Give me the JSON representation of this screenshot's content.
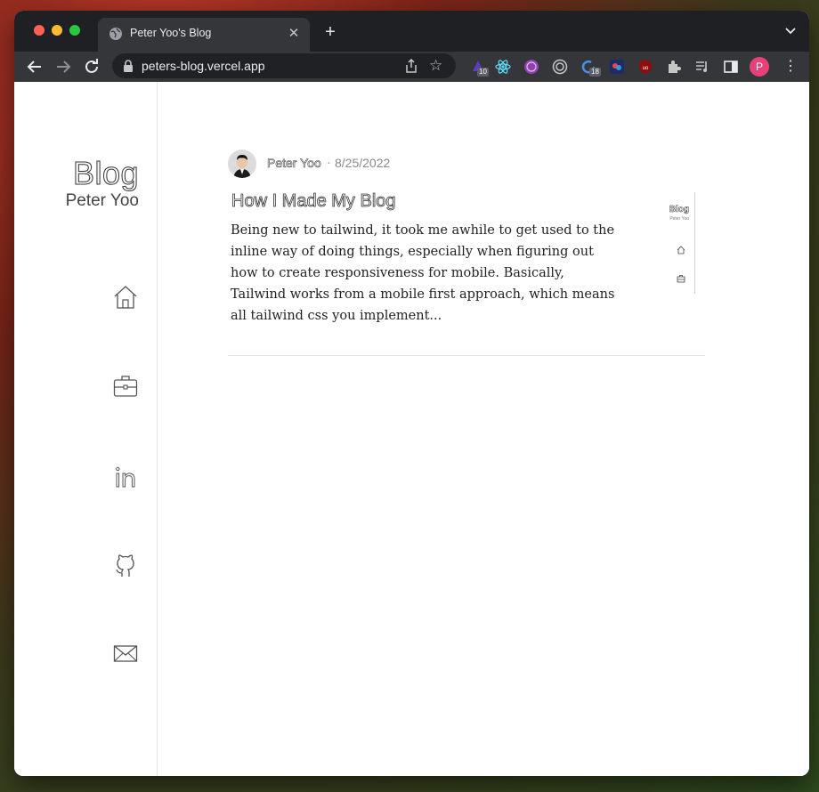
{
  "browser": {
    "tab_title": "Peter Yoo's Blog",
    "url": "peters-blog.vercel.app",
    "extensions": [
      {
        "name": "ext-wizard-icon",
        "badge": "10"
      },
      {
        "name": "react-devtools-icon",
        "badge": ""
      },
      {
        "name": "ext-globe-icon",
        "badge": ""
      },
      {
        "name": "ext-target-icon",
        "badge": ""
      },
      {
        "name": "ext-refresh-icon",
        "badge": "18"
      },
      {
        "name": "ext-colorful-icon",
        "badge": ""
      },
      {
        "name": "ublock-origin-icon",
        "badge": ""
      },
      {
        "name": "puzzle-extensions-icon",
        "badge": ""
      },
      {
        "name": "media-playlist-icon",
        "badge": ""
      },
      {
        "name": "side-panel-icon",
        "badge": ""
      }
    ],
    "profile_initial": "P",
    "colors": {
      "profile": "#e8417a"
    }
  },
  "sidebar": {
    "logo_title": "Blog",
    "logo_subtitle": "Peter Yoo",
    "nav": [
      {
        "icon": "home-icon"
      },
      {
        "icon": "briefcase-icon"
      },
      {
        "icon": "linkedin-icon"
      },
      {
        "icon": "github-icon"
      },
      {
        "icon": "mail-icon"
      }
    ]
  },
  "post": {
    "author": "Peter Yoo",
    "separator": "·",
    "date": "8/25/2022",
    "title": "How I Made My Blog",
    "excerpt": "Being new to tailwind, it took me awhile to get used to the inline way of doing things, especially when figuring out how to create responsiveness for mobile. Basically, Tailwind works from a mobile first approach, which means all tailwind css you implement...",
    "thumbnail": {
      "title": "Blog",
      "subtitle": "Peter Yoo"
    }
  }
}
